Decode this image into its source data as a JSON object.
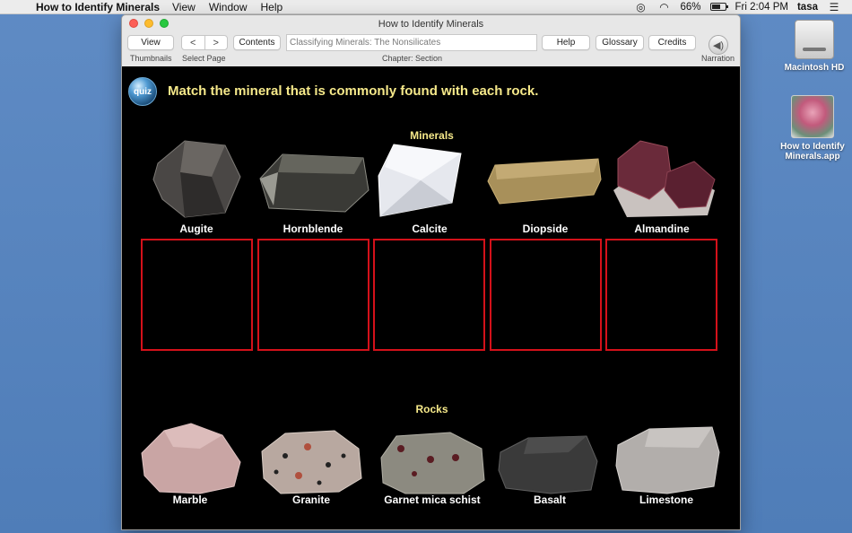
{
  "menubar": {
    "app_name": "How to Identify Minerals",
    "menus": [
      "View",
      "Window",
      "Help"
    ],
    "battery_percent": "66%",
    "battery_level": 0.66,
    "clock": "Fri 2:04 PM",
    "user": "tasa"
  },
  "desktop": {
    "icons": [
      {
        "label": "Macintosh HD"
      },
      {
        "label": "How to Identify Minerals.app"
      }
    ]
  },
  "window": {
    "title": "How to Identify Minerals",
    "toolbar": {
      "view_label": "View",
      "back_glyph": "<",
      "forward_glyph": ">",
      "contents_label": "Contents",
      "chapter_placeholder": "Classifying Minerals: The Nonsilicates",
      "help_label": "Help",
      "glossary_label": "Glossary",
      "credits_label": "Credits",
      "thumbnails_label": "Thumbnails",
      "select_page_label": "Select Page",
      "chapter_section_label": "Chapter: Section",
      "narration_label": "Narration"
    }
  },
  "quiz": {
    "badge": "quiz",
    "title": "Match the mineral that is commonly found with each rock.",
    "minerals_heading": "Minerals",
    "rocks_heading": "Rocks",
    "minerals": [
      {
        "name": "Augite",
        "color": "#4a4745"
      },
      {
        "name": "Hornblende",
        "color": "#3a3a36"
      },
      {
        "name": "Calcite",
        "color": "#e6e8ee"
      },
      {
        "name": "Diopside",
        "color": "#a8905a"
      },
      {
        "name": "Almandine",
        "color": "#6a2a3a"
      }
    ],
    "rocks": [
      {
        "name": "Marble",
        "color": "#c9a5a4"
      },
      {
        "name": "Granite",
        "color": "#b8a8a0"
      },
      {
        "name": "Garnet mica schist",
        "color": "#8c8a80"
      },
      {
        "name": "Basalt",
        "color": "#3a3a3a"
      },
      {
        "name": "Limestone",
        "color": "#b2aeab"
      }
    ],
    "drop_box_color": "#d4111a",
    "accent_color": "#f6e98a"
  }
}
